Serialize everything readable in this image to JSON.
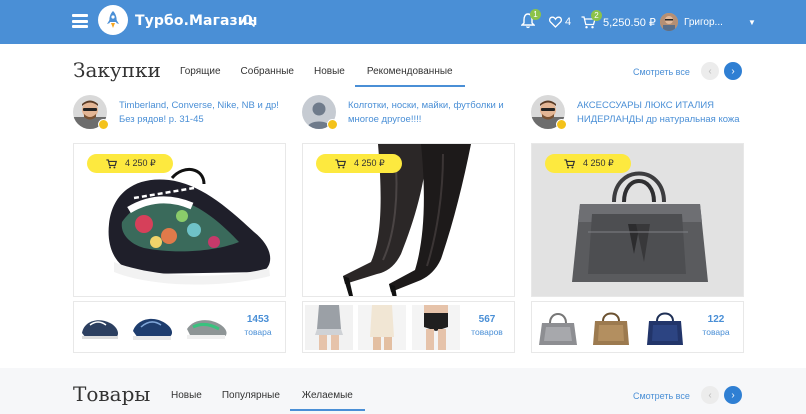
{
  "header": {
    "logo_text": "Турбо.Магазин",
    "notifications_count": "1",
    "favorites_count": "4",
    "cart_count": "2",
    "cart_amount": "5,250.50 ₽",
    "user_name": "Григор...",
    "accent_color": "#4a8fd6"
  },
  "purchases": {
    "title": "Закупки",
    "tabs": [
      "Горящие",
      "Собранные",
      "Новые",
      "Рекомендованные"
    ],
    "active_tab": "Рекомендованные",
    "see_all": "Смотреть все",
    "cards": [
      {
        "title": "Timberland, Converse, Nike, NB и др! Без рядов! р. 31-45",
        "price": "4 250 ₽",
        "count": "1453",
        "count_label": "товара",
        "image": "sneaker"
      },
      {
        "title": "Колготки, носки, майки, футболки и многое другое!!!!",
        "price": "4 250 ₽",
        "count": "567",
        "count_label": "товаров",
        "image": "stockings"
      },
      {
        "title": "АКСЕССУАРЫ ЛЮКС ИТАЛИЯ НИДЕРЛАНДЫ др натуральная кожа",
        "price": "4 250 ₽",
        "count": "122",
        "count_label": "товара",
        "image": "handbag"
      }
    ]
  },
  "goods": {
    "title": "Товары",
    "tabs": [
      "Новые",
      "Популярные",
      "Желаемые"
    ],
    "active_tab": "Желаемые",
    "see_all": "Смотреть все"
  }
}
